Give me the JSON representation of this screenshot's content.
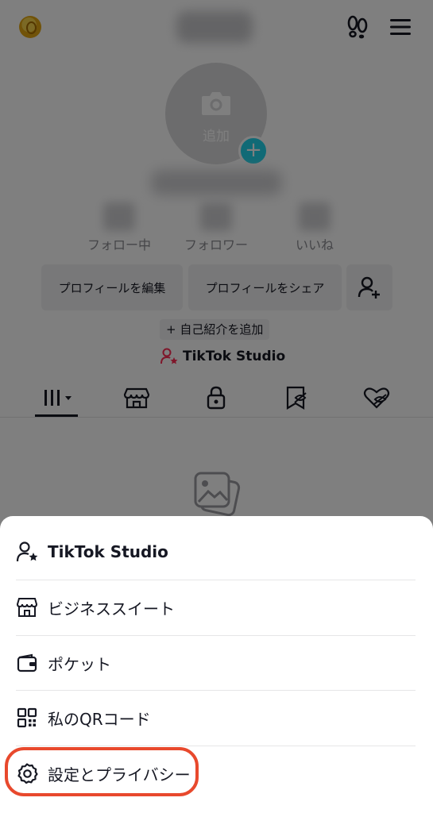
{
  "profile": {
    "avatar_add_label": "追加",
    "stats": [
      {
        "label": "フォロー中"
      },
      {
        "label": "フォロワー"
      },
      {
        "label": "いいね"
      }
    ],
    "edit_profile_label": "プロフィールを編集",
    "share_profile_label": "プロフィールをシェア",
    "add_bio_label": "+ 自己紹介を追加",
    "studio_link_label": "TikTok Studio"
  },
  "tabs": [
    {
      "icon": "grid-icon"
    },
    {
      "icon": "shop-icon"
    },
    {
      "icon": "lock-icon"
    },
    {
      "icon": "tagged-icon"
    },
    {
      "icon": "liked-icon"
    }
  ],
  "sheet": {
    "items": [
      {
        "label": "TikTok Studio",
        "icon": "person-star-icon"
      },
      {
        "label": "ビジネススイート",
        "icon": "storefront-icon"
      },
      {
        "label": "ポケット",
        "icon": "wallet-icon"
      },
      {
        "label": "私のQRコード",
        "icon": "qr-code-icon"
      },
      {
        "label": "設定とプライバシー",
        "icon": "gear-icon"
      }
    ]
  },
  "colors": {
    "accent_cyan": "#20d5ec",
    "highlight_red": "#e8492d",
    "studio_red": "#fe2c55"
  }
}
